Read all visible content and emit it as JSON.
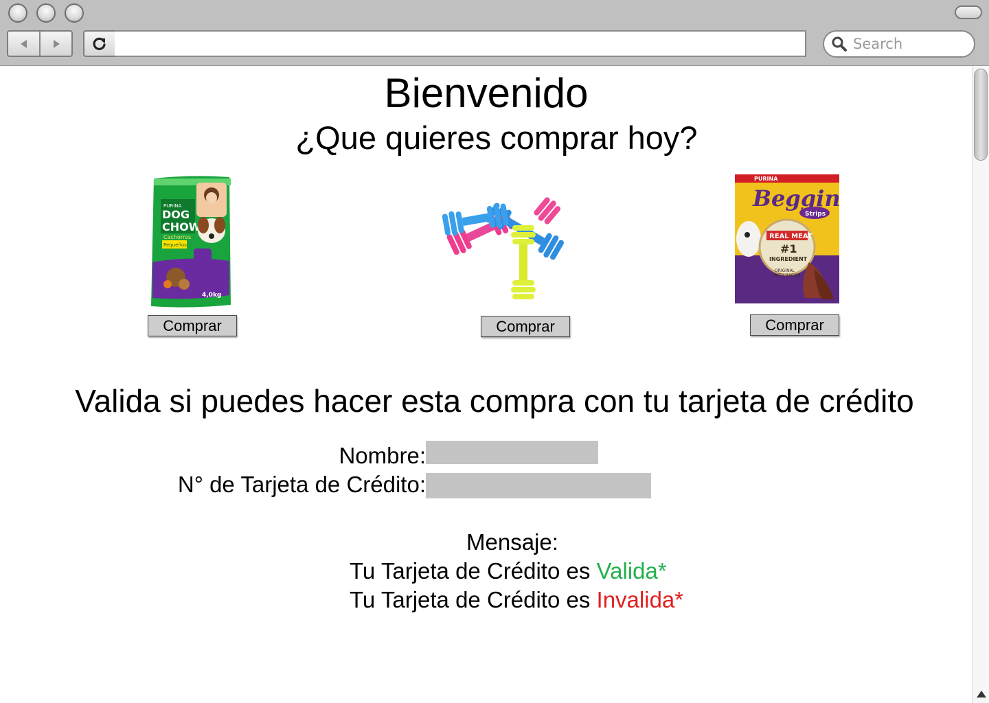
{
  "browser": {
    "url": "",
    "search_placeholder": "Search"
  },
  "page": {
    "title": "Bienvenido",
    "subtitle": "¿Que quieres comprar hoy?",
    "products": [
      {
        "button_label": "Comprar",
        "pack_text": [
          "PURINA",
          "DOG",
          "CHOW",
          "Cachorros",
          "Pequeños",
          "4,0kg"
        ]
      },
      {
        "button_label": "Comprar"
      },
      {
        "button_label": "Comprar",
        "pack_text": [
          "PURINA",
          "Beggin'",
          "Strips",
          "REAL MEAT",
          "#1",
          "INGREDIENT",
          "ORIGINAL",
          "WITH BACON"
        ]
      }
    ],
    "validation_title": "Valida si puedes hacer esta compra con tu tarjeta de crédito",
    "form": {
      "name_label": "Nombre:",
      "name_value": "",
      "card_label": "N° de Tarjeta de Crédito:",
      "card_value": ""
    },
    "message": {
      "label": "Mensaje:",
      "prefix": "Tu Tarjeta de Crédito es ",
      "valid_word": "Valida*",
      "invalid_word": "Invalida*"
    }
  },
  "colors": {
    "valid": "#22b14c",
    "invalid": "#e02020",
    "chrome": "#c0c0c0",
    "input_fill": "#c4c4c4"
  },
  "icons": [
    "back-arrow-icon",
    "forward-arrow-icon",
    "reload-icon",
    "search-icon"
  ]
}
